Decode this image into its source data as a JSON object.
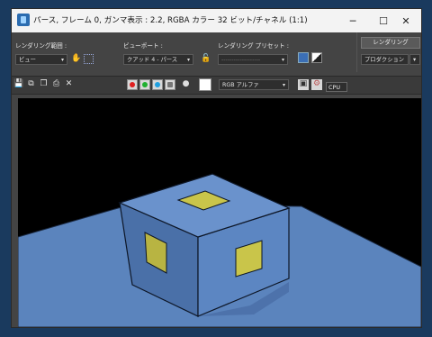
{
  "window": {
    "title": "パース, フレーム 0, ガンマ表示 : 2.2, RGBA カラー 32 ビット/チャネル (1:1)",
    "icon": "app-icon",
    "controls": {
      "minimize": "─",
      "maximize": "☐",
      "close": "✕"
    }
  },
  "options": {
    "area_label": "レンダリング範囲 :",
    "area_value": "ビュー",
    "viewport_label": "ビューポート :",
    "viewport_value": "クアッド 4 - パース",
    "preset_label": "レンダリング プリセット :",
    "preset_value": "-------------------",
    "render_button": "レンダリング",
    "production_value": "プロダクション",
    "arrow": "▾"
  },
  "toolbar": {
    "channel_value": "RGB アルファ",
    "cpu_label": "CPU",
    "icons": [
      "save-icon",
      "copy-icon",
      "clone-icon",
      "print-icon",
      "clear-icon",
      "red-channel-icon",
      "green-channel-icon",
      "blue-channel-icon",
      "alpha-channel-icon",
      "mono-icon",
      "color-swatch",
      "display-icon",
      "cpu-icon"
    ],
    "channel_colors": {
      "red": "#e02020",
      "green": "#20b030",
      "blue": "#20a0e0"
    }
  },
  "scene": {
    "ground_color": "#5b84bd",
    "box_top_color": "#6a92cc",
    "box_left_color": "#4a70a8",
    "box_right_color": "#5c86c2",
    "panel_color": "#c9c54a"
  }
}
